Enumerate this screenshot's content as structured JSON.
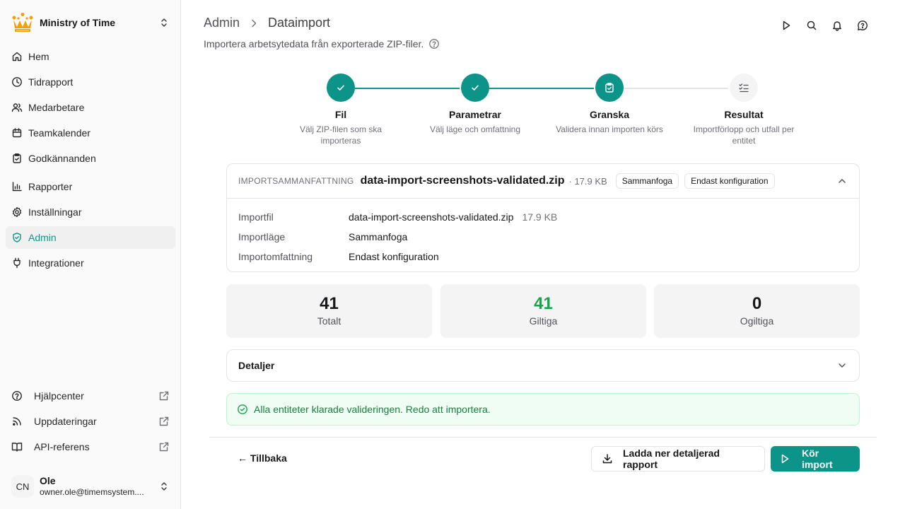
{
  "workspace": {
    "name": "Ministry of Time"
  },
  "sidebar": {
    "items": [
      {
        "label": "Hem",
        "icon": "home-icon"
      },
      {
        "label": "Tidrapport",
        "icon": "clock-icon"
      },
      {
        "label": "Medarbetare",
        "icon": "users-icon"
      },
      {
        "label": "Teamkalender",
        "icon": "calendar-icon"
      },
      {
        "label": "Godkännanden",
        "icon": "clipboard-check-icon"
      },
      {
        "label": "Rapporter",
        "icon": "chart-icon"
      },
      {
        "label": "Inställningar",
        "icon": "gear-icon"
      },
      {
        "label": "Admin",
        "icon": "shield-icon",
        "active": true
      },
      {
        "label": "Integrationer",
        "icon": "plug-icon"
      }
    ],
    "footer_items": [
      {
        "label": "Hjälpcenter",
        "icon": "help-circle-icon"
      },
      {
        "label": "Uppdateringar",
        "icon": "rss-icon"
      },
      {
        "label": "API-referens",
        "icon": "book-icon"
      }
    ]
  },
  "user": {
    "initials": "CN",
    "name": "Ole",
    "email": "owner.ole@timemsystem...."
  },
  "header": {
    "breadcrumb": [
      "Admin",
      "Dataimport"
    ],
    "subtitle": "Importera arbetsytedata från exporterade ZIP-filer."
  },
  "stepper": {
    "steps": [
      {
        "title": "Fil",
        "desc": "Välj ZIP-filen som ska importeras",
        "status": "done"
      },
      {
        "title": "Parametrar",
        "desc": "Välj läge och omfattning",
        "status": "done"
      },
      {
        "title": "Granska",
        "desc": "Validera innan importen körs",
        "status": "current"
      },
      {
        "title": "Resultat",
        "desc": "Importförlopp och utfall per entitet",
        "status": "todo"
      }
    ]
  },
  "summary": {
    "label": "IMPORTSAMMANFATTNING",
    "file": "data-import-screenshots-validated.zip",
    "size": "· 17.9 KB",
    "tags": [
      "Sammanfoga",
      "Endast konfiguration"
    ],
    "rows": [
      {
        "key": "Importfil",
        "value": "data-import-screenshots-validated.zip",
        "extra": "17.9 KB"
      },
      {
        "key": "Importläge",
        "value": "Sammanfoga"
      },
      {
        "key": "Importomfattning",
        "value": "Endast konfiguration"
      }
    ]
  },
  "stats": [
    {
      "value": "41",
      "label": "Totalt",
      "color": "#18181b"
    },
    {
      "value": "41",
      "label": "Giltiga",
      "color": "#16a34a"
    },
    {
      "value": "0",
      "label": "Ogiltiga",
      "color": "#18181b"
    }
  ],
  "details": {
    "title": "Detaljer"
  },
  "alert": {
    "text": "Alla entiteter klarade valideringen. Redo att importera."
  },
  "actions": {
    "back": "← Tillbaka",
    "download": "Ladda ner detaljerad rapport",
    "run": "Kör import"
  },
  "colors": {
    "accent": "#0d9488",
    "success": "#16a34a",
    "logo": "#f59e0b"
  }
}
